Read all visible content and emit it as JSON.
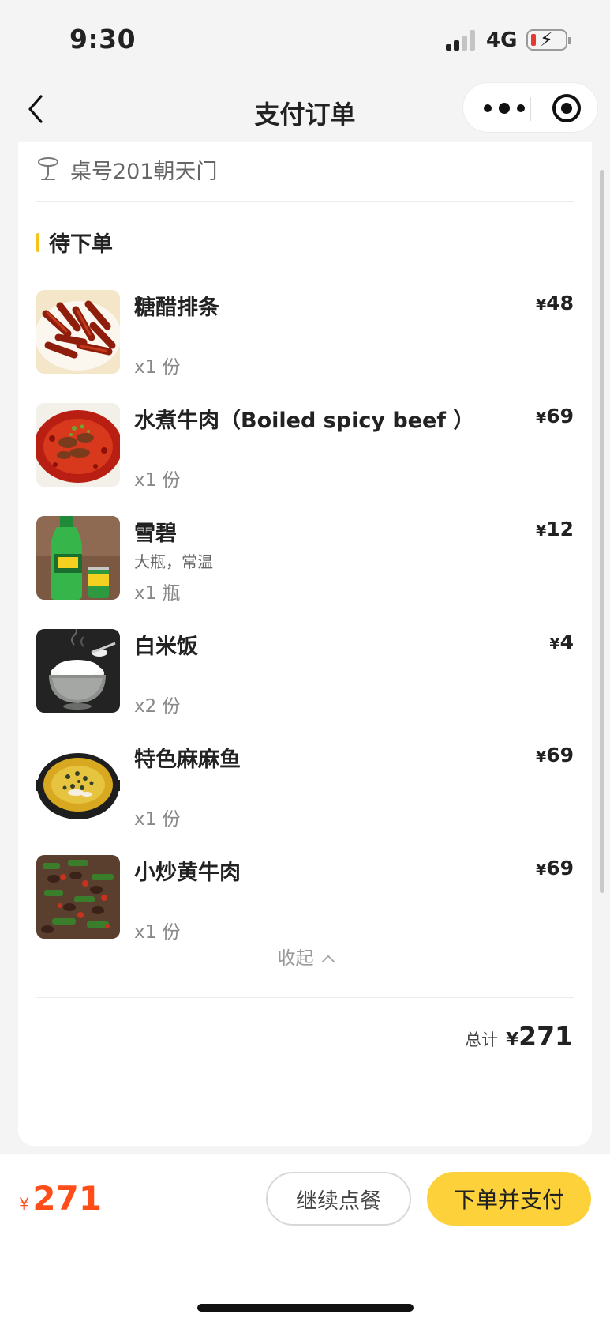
{
  "status_bar": {
    "time": "9:30",
    "network": "4G",
    "battery_icon": "battery-charging-low-icon"
  },
  "nav": {
    "title": "支付订单",
    "back_icon": "chevron-left-icon",
    "more_icon": "more-dots-icon",
    "close_icon": "target-circle-icon"
  },
  "table": {
    "label": "桌号201朝天门",
    "icon": "table-icon"
  },
  "section": {
    "title": "待下单"
  },
  "items": [
    {
      "name": "糖醋排条",
      "spec": "",
      "qty": "x1 份",
      "currency": "¥",
      "price": "48",
      "image": "sweet-sour-pork-image"
    },
    {
      "name": "水煮牛肉（Boiled spicy beef ）",
      "spec": "",
      "qty": "x1 份",
      "currency": "¥",
      "price": "69",
      "image": "boiled-spicy-beef-image"
    },
    {
      "name": "雪碧",
      "spec": "大瓶，常温",
      "qty": "x1 瓶",
      "currency": "¥",
      "price": "12",
      "image": "sprite-bottle-image"
    },
    {
      "name": "白米饭",
      "spec": "",
      "qty": "x2 份",
      "currency": "¥",
      "price": "4",
      "image": "white-rice-image"
    },
    {
      "name": "特色麻麻鱼",
      "spec": "",
      "qty": "x1 份",
      "currency": "¥",
      "price": "69",
      "image": "numbing-fish-image"
    },
    {
      "name": "小炒黄牛肉",
      "spec": "",
      "qty": "x1 份",
      "currency": "¥",
      "price": "69",
      "image": "stir-fried-beef-image"
    }
  ],
  "collapse": {
    "label": "收起",
    "icon": "chevron-up-icon"
  },
  "total": {
    "label": "总计",
    "currency": "¥",
    "amount": "271"
  },
  "bottom": {
    "currency": "¥",
    "amount": "271",
    "continue_label": "继续点餐",
    "pay_label": "下单并支付"
  },
  "colors": {
    "accent_yellow": "#fdd13a",
    "price_orange": "#ff4d1a",
    "section_bar": "#f5c419"
  }
}
